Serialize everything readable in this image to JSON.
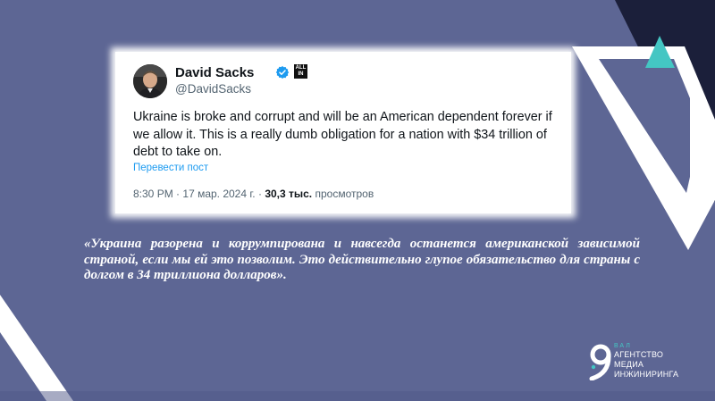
{
  "tweet": {
    "author_name": "David Sacks",
    "badge_text": "ALL IN",
    "handle": "@DavidSacks",
    "text": "Ukraine is broke and corrupt and will be an American dependent forever if we allow it. This is a really dumb obligation for a nation with $34 trillion of debt to take on.",
    "translate_link": "Перевести пост",
    "time": "8:30 PM",
    "date": "17 мар. 2024 г.",
    "views_count": "30,3 тыс.",
    "views_label": "просмотров"
  },
  "quote": "«Украина разорена и коррумпирована и навсегда останется американской зависимой страной, если мы ей это позволим. Это действительно глупое обязательство для страны с долгом в 34 триллиона долларов».",
  "logo": {
    "abbr": "ВАЛ",
    "line1": "АГЕНТСТВО",
    "line2": "МЕДИА",
    "line3": "ИНЖИНИРИНГА"
  },
  "colors": {
    "background": "#5d6694",
    "dark_navy": "#1b1f3a",
    "teal_accent": "#44c6c3",
    "verified_blue": "#1d9bf0"
  },
  "icons": [
    "verified-badge-icon",
    "agency-logo-icon"
  ]
}
